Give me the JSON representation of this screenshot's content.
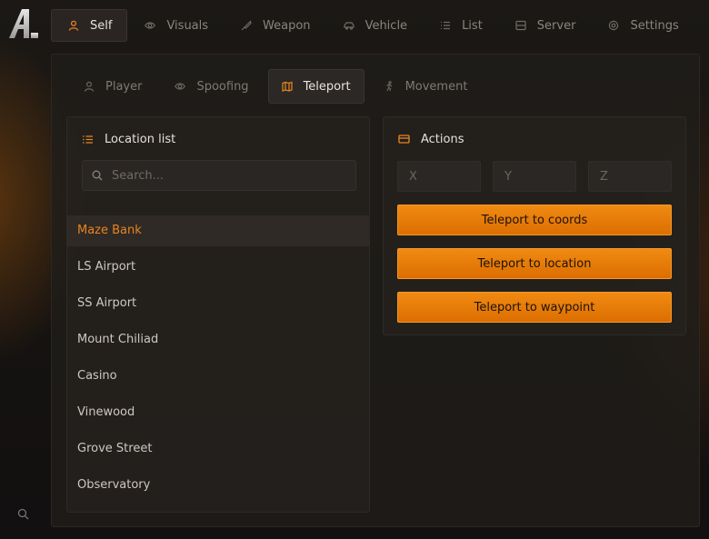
{
  "colors": {
    "accent": "#e9851f",
    "button": "#e67c08",
    "panel": "#201d1a"
  },
  "top_nav": {
    "tabs": [
      {
        "label": "Self",
        "icon": "user-icon",
        "active": true
      },
      {
        "label": "Visuals",
        "icon": "eye-icon",
        "active": false
      },
      {
        "label": "Weapon",
        "icon": "knife-icon",
        "active": false
      },
      {
        "label": "Vehicle",
        "icon": "car-icon",
        "active": false
      },
      {
        "label": "List",
        "icon": "list-icon",
        "active": false
      },
      {
        "label": "Server",
        "icon": "server-icon",
        "active": false
      },
      {
        "label": "Settings",
        "icon": "gear-icon",
        "active": false
      }
    ]
  },
  "sub_nav": {
    "tabs": [
      {
        "label": "Player",
        "icon": "user-icon",
        "active": false
      },
      {
        "label": "Spoofing",
        "icon": "eye-icon",
        "active": false
      },
      {
        "label": "Teleport",
        "icon": "map-icon",
        "active": true
      },
      {
        "label": "Movement",
        "icon": "running-icon",
        "active": false
      }
    ]
  },
  "location_card": {
    "title": "Location list",
    "search_placeholder": "Search...",
    "items": [
      {
        "label": "Maze Bank",
        "selected": true
      },
      {
        "label": "LS Airport",
        "selected": false
      },
      {
        "label": "SS Airport",
        "selected": false
      },
      {
        "label": "Mount Chiliad",
        "selected": false
      },
      {
        "label": "Casino",
        "selected": false
      },
      {
        "label": "Vinewood",
        "selected": false
      },
      {
        "label": "Grove Street",
        "selected": false
      },
      {
        "label": "Observatory",
        "selected": false
      }
    ]
  },
  "actions_card": {
    "title": "Actions",
    "x_placeholder": "X",
    "y_placeholder": "Y",
    "z_placeholder": "Z",
    "buttons": {
      "coords": "Teleport to coords",
      "location": "Teleport to location",
      "waypoint": "Teleport to waypoint"
    }
  }
}
